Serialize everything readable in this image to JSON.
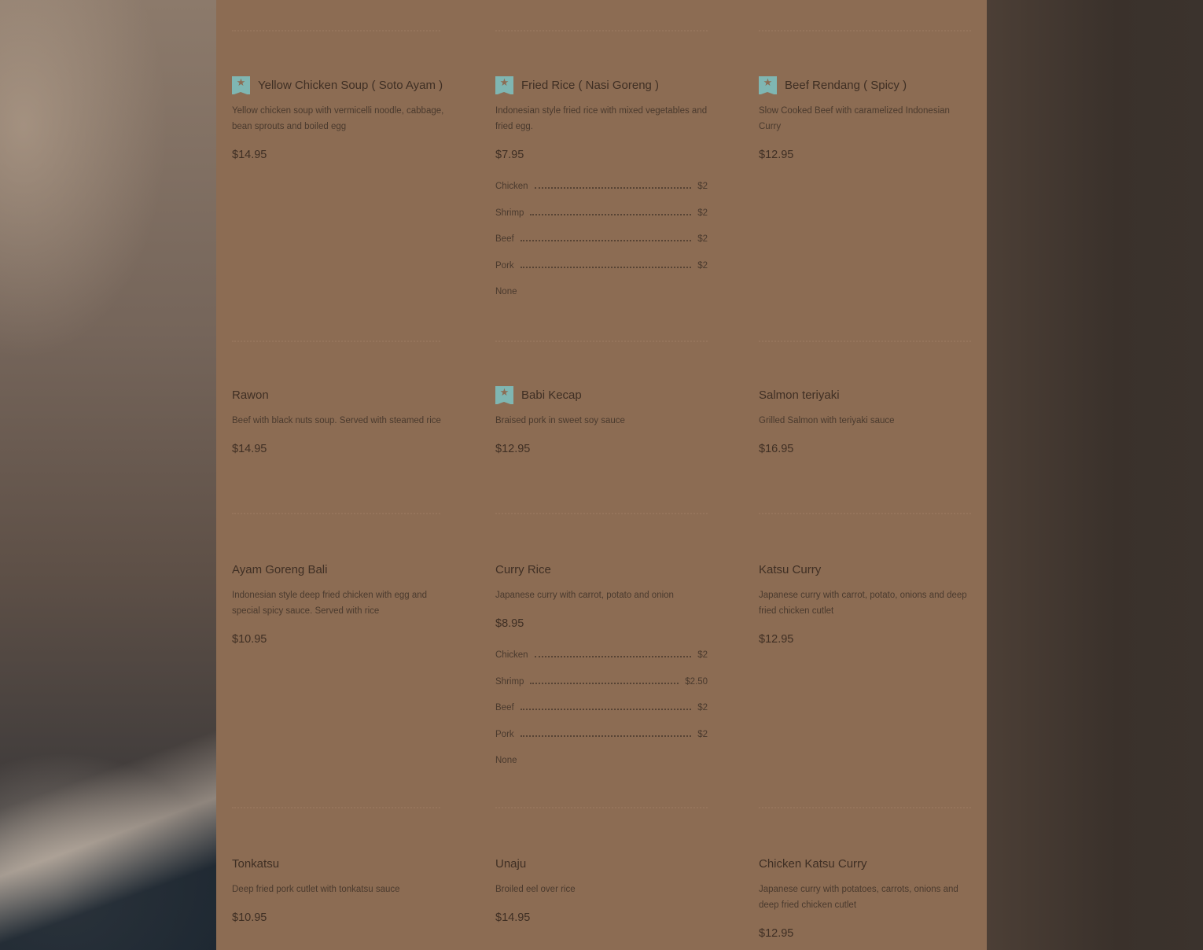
{
  "colors": {
    "panel": "#8c6c53",
    "badge": "#7fb6b2",
    "text": "#3f2f24"
  },
  "menu": [
    {
      "name": "Yellow Chicken Soup ( Soto Ayam )",
      "featured": true,
      "description": "Yellow chicken soup with vermicelli noodle, cabbage, bean sprouts and boiled egg",
      "price": "$14.95",
      "options": []
    },
    {
      "name": "Fried Rice ( Nasi Goreng )",
      "featured": true,
      "description": "Indonesian style fried rice with mixed vegetables and fried egg.",
      "price": "$7.95",
      "options": [
        {
          "label": "Chicken",
          "price": "$2"
        },
        {
          "label": "Shrimp",
          "price": "$2"
        },
        {
          "label": "Beef",
          "price": "$2"
        },
        {
          "label": "Pork",
          "price": "$2"
        },
        {
          "label": "None",
          "price": ""
        }
      ]
    },
    {
      "name": "Beef Rendang ( Spicy )",
      "featured": true,
      "description": "Slow Cooked Beef with caramelized Indonesian Curry",
      "price": "$12.95",
      "options": []
    },
    {
      "name": "Rawon",
      "featured": false,
      "description": "Beef with black nuts soup. Served with steamed rice",
      "price": "$14.95",
      "options": []
    },
    {
      "name": "Babi Kecap",
      "featured": true,
      "description": "Braised pork in sweet soy sauce",
      "price": "$12.95",
      "options": []
    },
    {
      "name": "Salmon teriyaki",
      "featured": false,
      "description": "Grilled Salmon with teriyaki sauce",
      "price": "$16.95",
      "options": []
    },
    {
      "name": "Ayam Goreng Bali",
      "featured": false,
      "description": "Indonesian style deep fried chicken with egg and special spicy sauce. Served with rice",
      "price": "$10.95",
      "options": []
    },
    {
      "name": "Curry Rice",
      "featured": false,
      "description": "Japanese curry with carrot, potato and onion",
      "price": "$8.95",
      "options": [
        {
          "label": "Chicken",
          "price": "$2"
        },
        {
          "label": "Shrimp",
          "price": "$2.50"
        },
        {
          "label": "Beef",
          "price": "$2"
        },
        {
          "label": "Pork",
          "price": "$2"
        },
        {
          "label": "None",
          "price": ""
        }
      ]
    },
    {
      "name": "Katsu Curry",
      "featured": false,
      "description": "Japanese curry with carrot, potato, onions and deep fried chicken cutlet",
      "price": "$12.95",
      "options": []
    },
    {
      "name": "Tonkatsu",
      "featured": false,
      "description": "Deep fried pork cutlet with tonkatsu sauce",
      "price": "$10.95",
      "options": []
    },
    {
      "name": "Unaju",
      "featured": false,
      "description": "Broiled eel over rice",
      "price": "$14.95",
      "options": []
    },
    {
      "name": "Chicken Katsu Curry",
      "featured": false,
      "description": "Japanese curry with potatoes, carrots, onions and deep fried chicken cutlet",
      "price": "$12.95",
      "options": []
    }
  ]
}
